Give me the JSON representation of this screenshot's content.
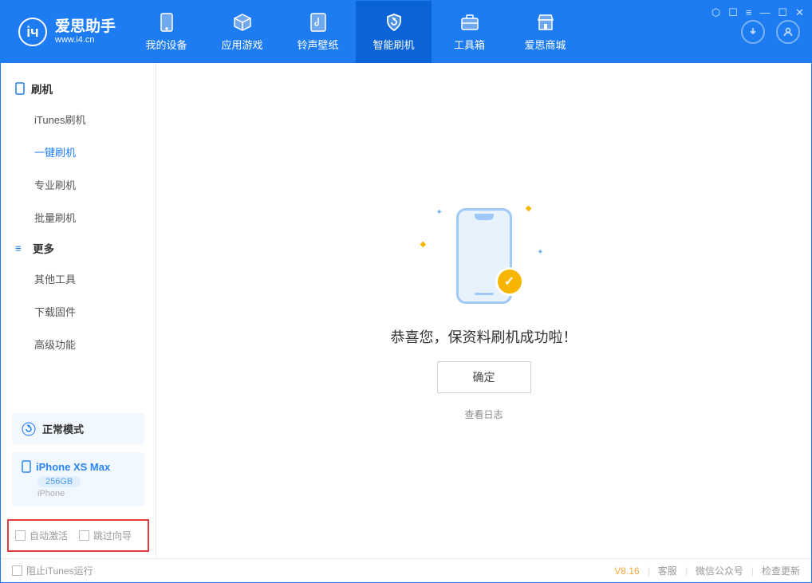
{
  "app": {
    "title": "爱思助手",
    "subtitle": "www.i4.cn"
  },
  "header": {
    "tabs": [
      {
        "label": "我的设备"
      },
      {
        "label": "应用游戏"
      },
      {
        "label": "铃声壁纸"
      },
      {
        "label": "智能刷机"
      },
      {
        "label": "工具箱"
      },
      {
        "label": "爱思商城"
      }
    ]
  },
  "sidebar": {
    "section_flash": "刷机",
    "items_flash": [
      "iTunes刷机",
      "一键刷机",
      "专业刷机",
      "批量刷机"
    ],
    "section_more": "更多",
    "items_more": [
      "其他工具",
      "下载固件",
      "高级功能"
    ]
  },
  "mode": {
    "label": "正常模式"
  },
  "device": {
    "name": "iPhone XS Max",
    "capacity": "256GB",
    "type": "iPhone"
  },
  "options": {
    "auto_activate": "自动激活",
    "skip_guide": "跳过向导"
  },
  "main": {
    "success": "恭喜您，保资料刷机成功啦！",
    "ok": "确定",
    "view_log": "查看日志"
  },
  "footer": {
    "block_itunes": "阻止iTunes运行",
    "version": "V8.16",
    "support": "客服",
    "wechat": "微信公众号",
    "update": "检查更新"
  }
}
